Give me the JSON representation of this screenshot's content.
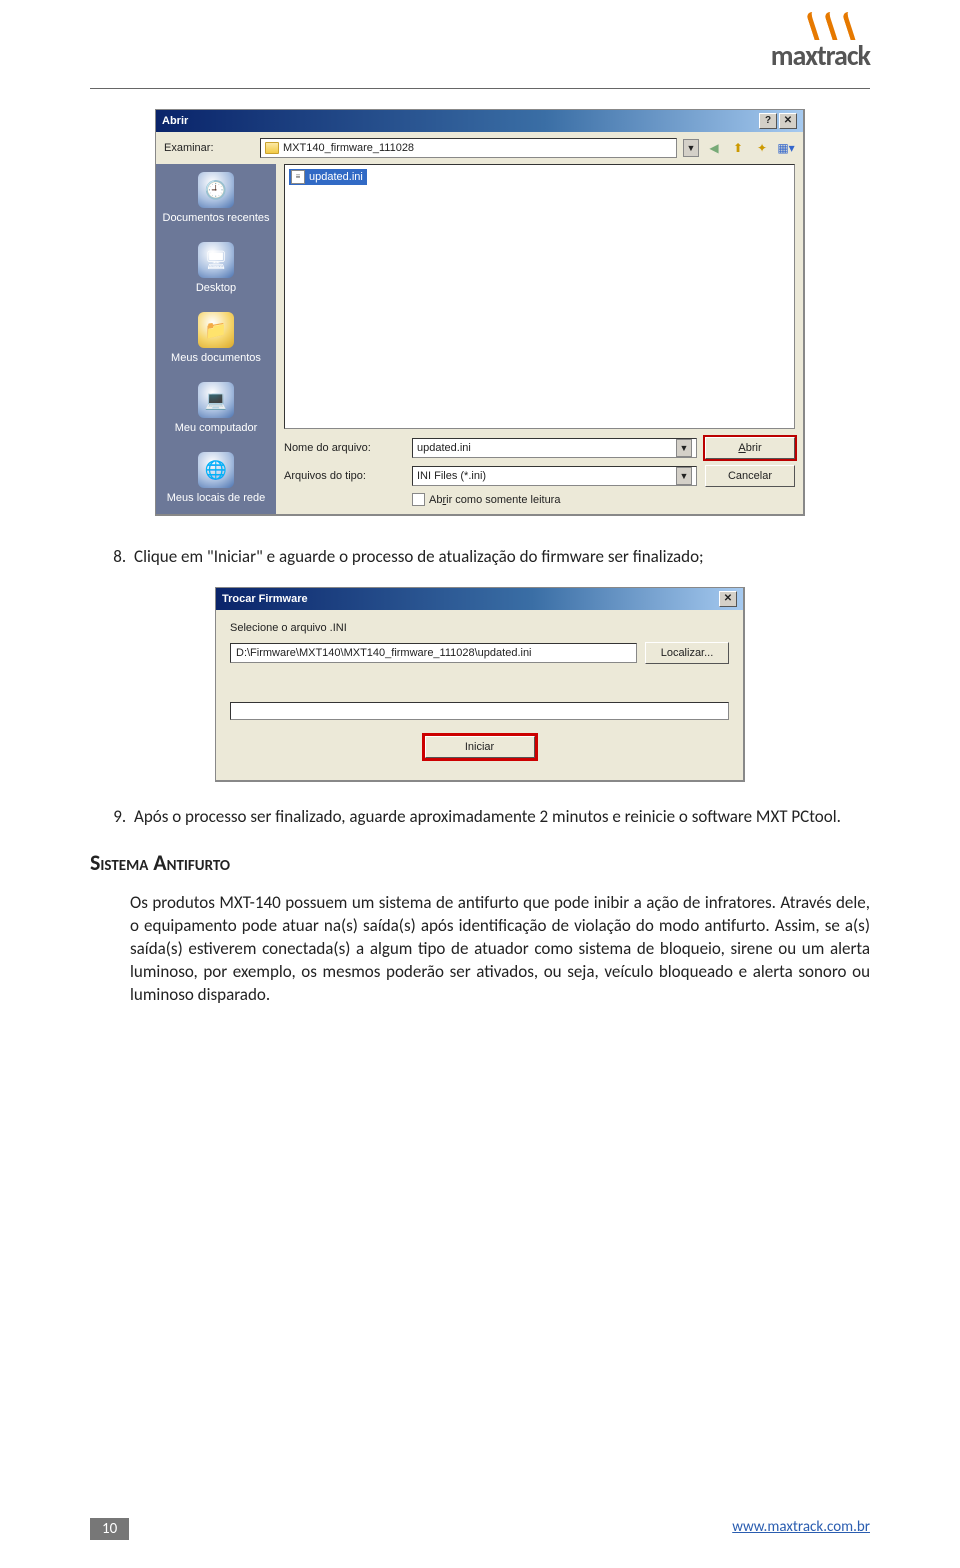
{
  "logo": {
    "text": "maxtrack"
  },
  "open_dialog": {
    "title": "Abrir",
    "help_btn": "?",
    "close_btn": "✕",
    "examine_label": "Examinar:",
    "examine_value": "MXT140_firmware_111028",
    "sidebar": [
      {
        "label": "Documentos recentes",
        "glyph": "🕘"
      },
      {
        "label": "Desktop",
        "glyph": "🖥"
      },
      {
        "label": "Meus documentos",
        "glyph": "📁"
      },
      {
        "label": "Meu computador",
        "glyph": "💻"
      },
      {
        "label": "Meus locais de rede",
        "glyph": "🌐"
      }
    ],
    "toolbar_icons": [
      "back-icon",
      "up-icon",
      "new-folder-icon",
      "views-icon"
    ],
    "file_item": "updated.ini",
    "filename_label": "Nome do arquivo:",
    "filename_value": "updated.ini",
    "filetype_label": "Arquivos do tipo:",
    "filetype_value": "INI Files (*.ini)",
    "open_btn": "Abrir",
    "cancel_btn": "Cancelar",
    "readonly_label": "Abrir como somente leitura"
  },
  "steps": {
    "eight": "Clique em \"Iniciar\" e aguarde o processo de atualização do firmware ser finalizado;",
    "nine": "Após o processo ser finalizado, aguarde aproximadamente 2 minutos e reinicie o software MXT PCtool."
  },
  "fw_dialog": {
    "title": "Trocar Firmware",
    "close_btn": "✕",
    "select_label": "Selecione o arquivo .INI",
    "path_value": "D:\\Firmware\\MXT140\\MXT140_firmware_111028\\updated.ini",
    "locate_btn": "Localizar...",
    "start_btn": "Iniciar"
  },
  "section_title": "Sistema Antifurto",
  "antifurto_p1": "Os produtos MXT-140 possuem um sistema de antifurto que pode inibir a ação de infratores. Através dele, o equipamento pode atuar na(s) saída(s) após identificação de violação do modo antifurto. Assim, se a(s) saída(s) estiverem conectada(s) a algum tipo de atuador como sistema de bloqueio, sirene ou um alerta luminoso, por exemplo, os mesmos poderão ser ativados, ou seja, veículo bloqueado e alerta sonoro ou luminoso disparado.",
  "footer": {
    "page": "10",
    "url": "www.maxtrack.com.br"
  }
}
